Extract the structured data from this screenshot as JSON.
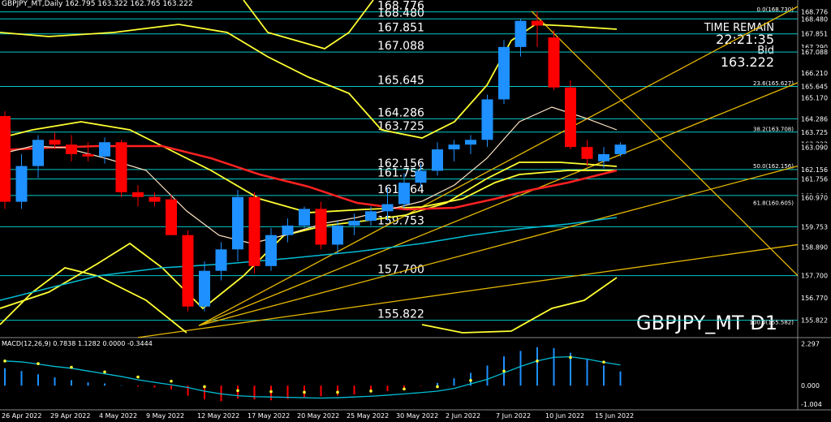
{
  "header": {
    "text": "GBPJPY_MT,Daily  162.795 163.322 162.765 163.222"
  },
  "time_remain": {
    "label": "TIME REMAIN",
    "value": "22:21:35",
    "bid_label": "Bid",
    "bid_value": "163.222"
  },
  "watermark": "GBPJPY_MT D1",
  "macd_header": "MACD(12,26,9) 0.7838 1.1282 0.0000 -0.3444",
  "colors": {
    "bull": "#1e90ff",
    "bear": "#ff0000",
    "level_line": "#00c8c8",
    "yellow": "#ffff33",
    "fib_green": "#33ff33"
  },
  "chart_data": {
    "type": "candlestick",
    "title": "GBPJPY_MT,Daily",
    "ylim": [
      155.3,
      169.0
    ],
    "xticks": [
      "26 Apr 2022",
      "29 Apr 2022",
      "4 May 2022",
      "9 May 2022",
      "12 May 2022",
      "17 May 2022",
      "20 May 2022",
      "25 May 2022",
      "30 May 2022",
      "2 Jun 2022",
      "7 Jun 2022",
      "10 Jun 2022",
      "15 Jun 2022"
    ],
    "yticks": [
      168.776,
      168.48,
      167.851,
      167.29,
      167.088,
      166.21,
      165.645,
      165.17,
      164.286,
      163.725,
      163.222,
      163.09,
      162.156,
      161.756,
      161.064,
      160.97,
      159.753,
      158.89,
      157.7,
      156.77,
      155.822
    ],
    "candles": [
      {
        "o": 164.4,
        "h": 164.6,
        "l": 160.5,
        "c": 160.8
      },
      {
        "o": 160.8,
        "h": 162.8,
        "l": 160.5,
        "c": 162.3
      },
      {
        "o": 162.3,
        "h": 163.6,
        "l": 161.8,
        "c": 163.4
      },
      {
        "o": 163.4,
        "h": 163.7,
        "l": 163.0,
        "c": 163.2
      },
      {
        "o": 163.2,
        "h": 163.6,
        "l": 162.5,
        "c": 162.8
      },
      {
        "o": 162.8,
        "h": 163.3,
        "l": 162.5,
        "c": 162.7
      },
      {
        "o": 162.7,
        "h": 163.5,
        "l": 162.4,
        "c": 163.3
      },
      {
        "o": 163.3,
        "h": 163.4,
        "l": 161.0,
        "c": 161.2
      },
      {
        "o": 161.2,
        "h": 161.5,
        "l": 160.6,
        "c": 161.0
      },
      {
        "o": 161.0,
        "h": 161.2,
        "l": 160.6,
        "c": 160.8
      },
      {
        "o": 160.9,
        "h": 161.1,
        "l": 159.4,
        "c": 159.4
      },
      {
        "o": 159.4,
        "h": 159.6,
        "l": 156.2,
        "c": 156.4
      },
      {
        "o": 156.4,
        "h": 158.3,
        "l": 156.2,
        "c": 157.9
      },
      {
        "o": 157.9,
        "h": 159.1,
        "l": 157.5,
        "c": 158.8
      },
      {
        "o": 158.8,
        "h": 161.3,
        "l": 158.3,
        "c": 161.0
      },
      {
        "o": 161.0,
        "h": 161.2,
        "l": 157.8,
        "c": 158.1
      },
      {
        "o": 158.1,
        "h": 159.7,
        "l": 157.9,
        "c": 159.4
      },
      {
        "o": 159.4,
        "h": 160.1,
        "l": 159.1,
        "c": 159.8
      },
      {
        "o": 159.8,
        "h": 160.6,
        "l": 159.7,
        "c": 160.5
      },
      {
        "o": 160.5,
        "h": 160.8,
        "l": 158.8,
        "c": 159.0
      },
      {
        "o": 159.0,
        "h": 160.0,
        "l": 158.6,
        "c": 159.8
      },
      {
        "o": 159.8,
        "h": 160.3,
        "l": 159.4,
        "c": 160.0
      },
      {
        "o": 160.0,
        "h": 160.6,
        "l": 159.8,
        "c": 160.4
      },
      {
        "o": 160.4,
        "h": 161.4,
        "l": 160.0,
        "c": 160.7
      },
      {
        "o": 160.7,
        "h": 162.0,
        "l": 160.5,
        "c": 161.6
      },
      {
        "o": 161.6,
        "h": 162.4,
        "l": 161.4,
        "c": 162.1
      },
      {
        "o": 162.1,
        "h": 163.3,
        "l": 161.9,
        "c": 163.0
      },
      {
        "o": 163.0,
        "h": 163.4,
        "l": 162.5,
        "c": 163.2
      },
      {
        "o": 163.2,
        "h": 163.6,
        "l": 162.8,
        "c": 163.4
      },
      {
        "o": 163.4,
        "h": 165.3,
        "l": 163.1,
        "c": 165.1
      },
      {
        "o": 165.1,
        "h": 167.6,
        "l": 164.9,
        "c": 167.3
      },
      {
        "o": 167.3,
        "h": 168.5,
        "l": 166.9,
        "c": 168.4
      },
      {
        "o": 168.4,
        "h": 168.8,
        "l": 167.3,
        "c": 168.2
      },
      {
        "o": 167.7,
        "h": 168.0,
        "l": 165.5,
        "c": 165.6
      },
      {
        "o": 165.6,
        "h": 165.9,
        "l": 163.0,
        "c": 163.1
      },
      {
        "o": 163.1,
        "h": 163.4,
        "l": 162.3,
        "c": 162.6
      },
      {
        "o": 162.5,
        "h": 163.1,
        "l": 162.2,
        "c": 162.8
      },
      {
        "o": 162.8,
        "h": 163.3,
        "l": 162.7,
        "c": 163.2
      }
    ],
    "levels": [
      {
        "label": "168.776",
        "value": 168.776
      },
      {
        "label": "168.480",
        "value": 168.48
      },
      {
        "label": "167.851",
        "value": 167.851
      },
      {
        "label": "167.088",
        "value": 167.088
      },
      {
        "label": "165.645",
        "value": 165.645
      },
      {
        "label": "164.286",
        "value": 164.286
      },
      {
        "label": "163.725",
        "value": 163.725
      },
      {
        "label": "162.156",
        "value": 162.156
      },
      {
        "label": "161.756",
        "value": 161.756
      },
      {
        "label": "161.064",
        "value": 161.064
      },
      {
        "label": "159.753",
        "value": 159.753
      },
      {
        "label": "157.700",
        "value": 157.7
      },
      {
        "label": "155.822",
        "value": 155.822
      }
    ],
    "fib_labels": [
      {
        "label": "0.0(168.730)",
        "value": 168.73
      },
      {
        "label": "23.6(165.627)",
        "value": 165.627
      },
      {
        "label": "38.2(163.708)",
        "value": 163.708
      },
      {
        "label": "50.0(162.156)",
        "value": 162.156
      },
      {
        "label": "61.8(160.605)",
        "value": 160.605
      },
      {
        "label": "100.0(155.582)",
        "value": 155.582
      }
    ],
    "macd": {
      "ylim": [
        -1.1,
        2.45
      ],
      "yticks": [
        2.297,
        0.0,
        -1.004
      ],
      "histogram": [
        0.95,
        0.8,
        0.62,
        0.45,
        0.3,
        0.18,
        0.12,
        0.02,
        -0.05,
        -0.1,
        -0.2,
        -0.55,
        -0.75,
        -0.85,
        -0.7,
        -0.75,
        -0.8,
        -0.72,
        -0.62,
        -0.58,
        -0.54,
        -0.48,
        -0.38,
        -0.3,
        -0.2,
        -0.02,
        0.15,
        0.4,
        0.7,
        1.1,
        1.6,
        1.9,
        2.1,
        2.05,
        1.8,
        1.45,
        1.1,
        0.78
      ],
      "signal": [
        1.35,
        1.3,
        1.18,
        1.05,
        0.95,
        0.8,
        0.65,
        0.5,
        0.32,
        0.18,
        0.05,
        -0.1,
        -0.3,
        -0.45,
        -0.55,
        -0.6,
        -0.62,
        -0.64,
        -0.66,
        -0.68,
        -0.66,
        -0.62,
        -0.58,
        -0.52,
        -0.45,
        -0.38,
        -0.3,
        -0.15,
        0.1,
        0.35,
        0.7,
        1.05,
        1.35,
        1.55,
        1.58,
        1.45,
        1.28,
        1.13
      ]
    }
  }
}
